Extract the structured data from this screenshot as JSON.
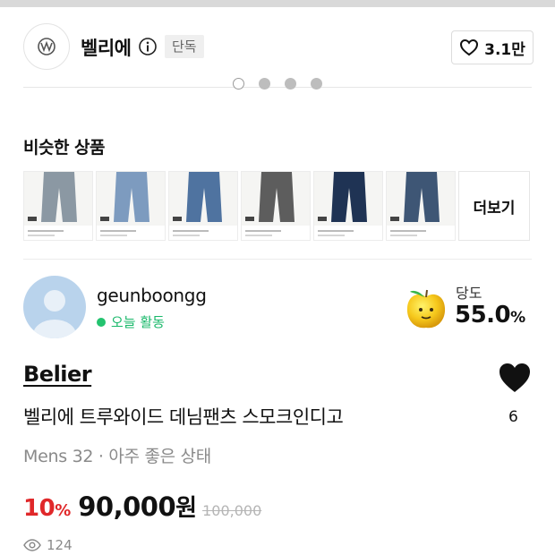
{
  "shop": {
    "name": "벨리에",
    "badge": "단독",
    "likes": "3.1만"
  },
  "carousel": {
    "pages": 4,
    "active": 0
  },
  "similar": {
    "title": "비슷한 상품",
    "more_label": "더보기",
    "thumbnails": [
      {
        "denim_color": "#8b98a3"
      },
      {
        "denim_color": "#7d9bbf"
      },
      {
        "denim_color": "#4f73a0"
      },
      {
        "denim_color": "#5d5d5d"
      },
      {
        "denim_color": "#1f3354"
      },
      {
        "denim_color": "#3e5675"
      }
    ]
  },
  "seller": {
    "name": "geunboongg",
    "status": "오늘 활동",
    "sweetness_label": "당도",
    "sweetness_value": "55.0",
    "sweetness_unit": "%"
  },
  "product": {
    "brand": "Belier",
    "title": "벨리에 트루와이드 데님팬츠 스모크인디고",
    "subtitle": "Mens 32 · 아주 좋은 상태",
    "like_count": "6",
    "discount": "10",
    "discount_unit": "%",
    "price": "90,000",
    "currency": "원",
    "original_price": "100,000",
    "views": "124"
  },
  "colors": {
    "discount_red": "#e0282a",
    "active_green": "#23c36f",
    "avatar_blue": "#b9d3ec"
  }
}
